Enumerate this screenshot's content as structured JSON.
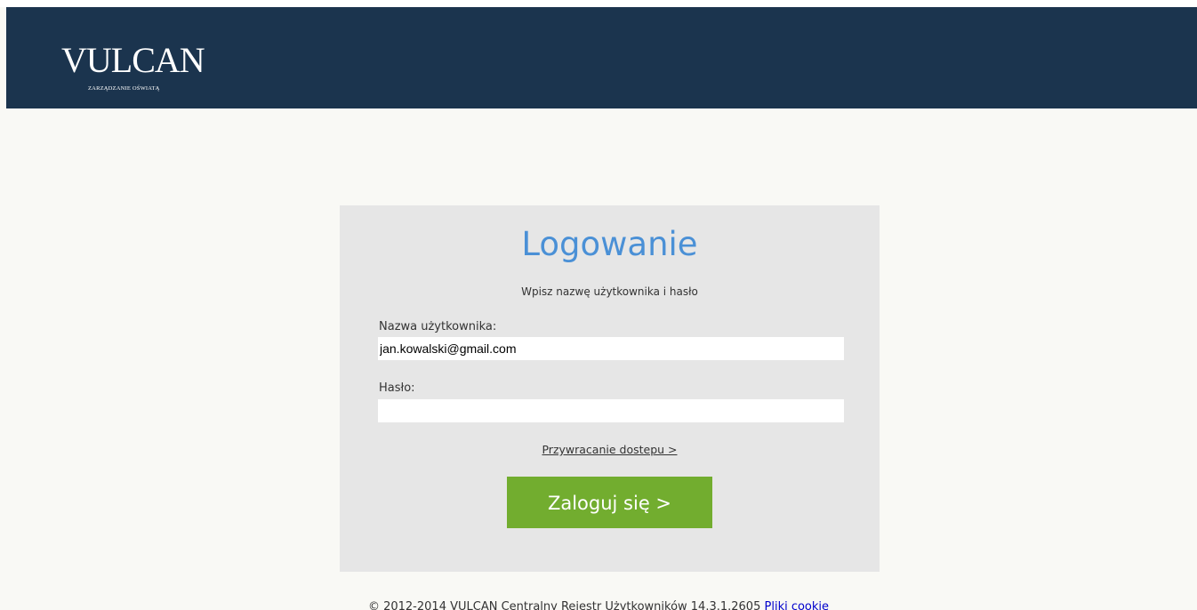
{
  "header": {
    "logo_text": "VULCAN",
    "logo_subtext": "ZARZĄDZANIE OŚWIATĄ",
    "background_color": "#1b344e"
  },
  "login": {
    "title": "Logowanie",
    "subtitle": "Wpisz nazwę użytkownika i hasło",
    "username_label": "Nazwa użytkownika:",
    "username_value": "jan.kowalski@gmail.com",
    "password_label": "Hasło:",
    "password_value": "",
    "restore_link": "Przywracanie dostepu >",
    "submit_label": "Zaloguj się >",
    "title_color": "#4a90d6",
    "button_color": "#72ad2f"
  },
  "footer": {
    "copyright": "© 2012-2014 VULCAN Centralny Rejestr Użytkowników 14.3.1.2605 ",
    "cookie_link": "Pliki cookie"
  }
}
